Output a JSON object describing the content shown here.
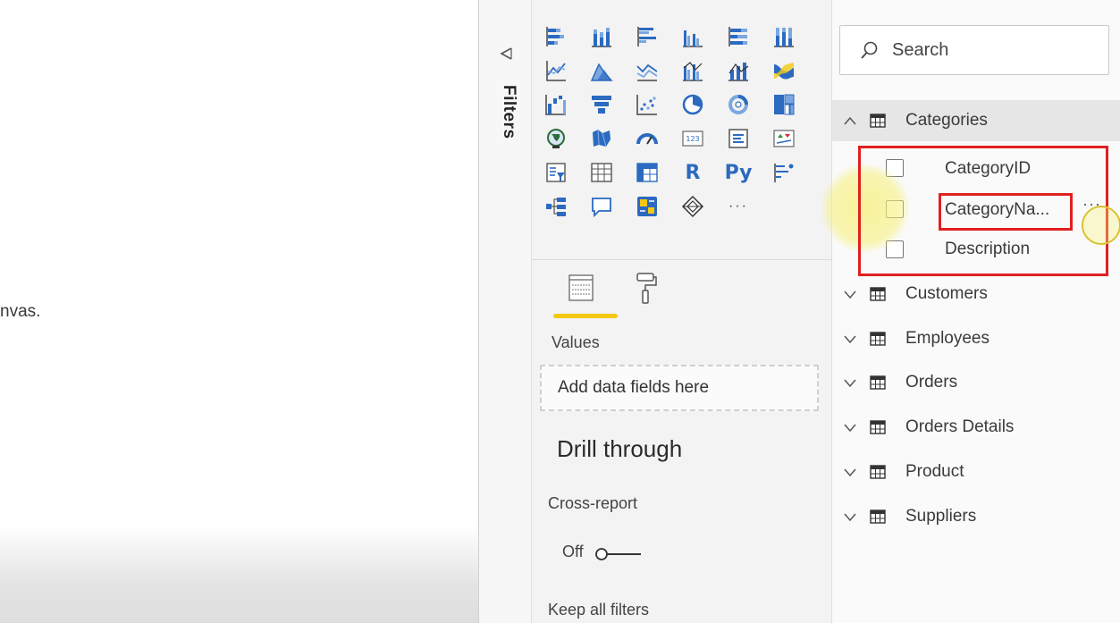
{
  "canvas": {
    "partial_text": "nvas."
  },
  "filters": {
    "label": "Filters"
  },
  "visualizations": {
    "icons": [
      "stacked-bar-chart-icon",
      "stacked-column-chart-icon",
      "clustered-bar-chart-icon",
      "clustered-column-chart-icon",
      "100-stacked-bar-chart-icon",
      "100-stacked-column-chart-icon",
      "line-chart-icon",
      "area-chart-icon",
      "stacked-area-chart-icon",
      "line-clustered-column-chart-icon",
      "line-stacked-column-chart-icon",
      "ribbon-chart-icon",
      "waterfall-chart-icon",
      "funnel-chart-icon",
      "scatter-chart-icon",
      "pie-chart-icon",
      "donut-chart-icon",
      "treemap-icon",
      "map-icon",
      "filled-map-icon",
      "gauge-icon",
      "card-icon",
      "multi-row-card-icon",
      "kpi-icon",
      "slicer-icon",
      "table-icon",
      "matrix-icon",
      "r-visual-icon",
      "python-visual-icon",
      "key-influencers-icon",
      "decomposition-tree-icon",
      "qa-icon",
      "smart-narrative-icon",
      "power-apps-icon",
      "more-visuals-icon"
    ],
    "r_label": "R",
    "py_label": "Py",
    "more_label": "···",
    "values_label": "Values",
    "drop_placeholder": "Add data fields here",
    "drill_through_title": "Drill through",
    "cross_report_label": "Cross-report",
    "toggle_state": "Off",
    "keep_filters_label": "Keep all filters",
    "accent": "#f2c811"
  },
  "fields": {
    "search_placeholder": "Search",
    "tables": [
      {
        "name": "Categories",
        "expanded": true,
        "fields": [
          "CategoryID",
          "CategoryNa...",
          "Description"
        ]
      },
      {
        "name": "Customers",
        "expanded": false
      },
      {
        "name": "Employees",
        "expanded": false
      },
      {
        "name": "Orders",
        "expanded": false
      },
      {
        "name": "Orders Details",
        "expanded": false
      },
      {
        "name": "Product",
        "expanded": false
      },
      {
        "name": "Suppliers",
        "expanded": false
      }
    ],
    "more_options": "···",
    "highlight_color": "#e02020"
  }
}
